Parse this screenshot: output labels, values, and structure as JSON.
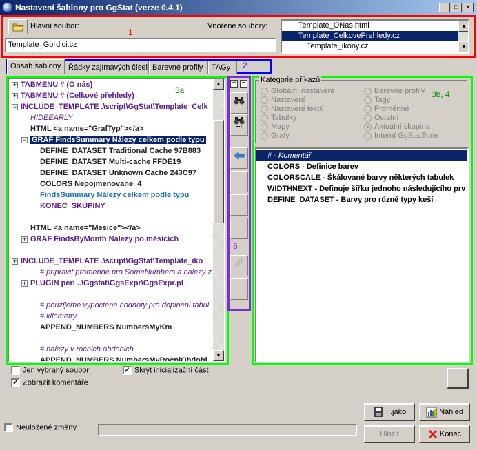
{
  "window": {
    "title": "Nastavení šablony pro GgStat (verze 0.4.1)",
    "btn_minimize": "_",
    "btn_maximize": "□",
    "btn_close": "×"
  },
  "header": {
    "main_file_label": "Hlavní soubor:",
    "main_file_value": "Template_Gordici.cz",
    "nested_files_label": "Vnořené soubory:",
    "nested_files": [
      "Template_ONas.html",
      "Template_CelkovePrehledy.cz",
      "Template_ikony.cz"
    ],
    "nested_selected_index": 1
  },
  "annotations": {
    "a1": "1",
    "a2": "2",
    "a3a": "3a",
    "a3b4": "3b, 4",
    "a6": "6"
  },
  "tabs": [
    "Obsah šablony",
    "Řádky zajímavých čísel",
    "Barevné profily",
    "TAGy"
  ],
  "tree": [
    {
      "text": "TABMENU  # (O nás)",
      "style": "purple",
      "exp": "+",
      "indent": 0
    },
    {
      "text": "TABMENU  # (Celkové přehledy)",
      "style": "purple",
      "exp": "+",
      "indent": 0
    },
    {
      "text": "INCLUDE_TEMPLATE .\\script\\GgStat\\Template_Celk",
      "style": "purple",
      "exp": "−",
      "indent": 0
    },
    {
      "text": "HIDEEARLY",
      "style": "comment",
      "exp": "",
      "indent": 1
    },
    {
      "text": "HTML <a name=\"GrafTyp\"></a>",
      "style": "black",
      "exp": "",
      "indent": 1
    },
    {
      "text": "GRAF FindsSummary Nálezy celkem podle typu",
      "style": "selected",
      "exp": "−",
      "indent": 1
    },
    {
      "text": "DEFINE_DATASET Traditional Cache 97B883",
      "style": "black",
      "exp": "",
      "indent": 2
    },
    {
      "text": "DEFINE_DATASET Multi-cache FFDE19",
      "style": "black",
      "exp": "",
      "indent": 2
    },
    {
      "text": "DEFINE_DATASET Unknown Cache 243C97",
      "style": "black",
      "exp": "",
      "indent": 2
    },
    {
      "text": "COLORS Nepojmenovane_4",
      "style": "black",
      "exp": "",
      "indent": 2
    },
    {
      "text": "FindsSummary Nálezy celkem podle typu",
      "style": "blue",
      "exp": "",
      "indent": 2
    },
    {
      "text": "KONEC_SKUPINY",
      "style": "purple",
      "exp": "",
      "indent": 2
    },
    {
      "text": "",
      "style": "black",
      "exp": "",
      "indent": 0
    },
    {
      "text": "HTML <a name=\"Mesice\"></a>",
      "style": "black",
      "exp": "",
      "indent": 1
    },
    {
      "text": "GRAF FindsByMonth Nálezy po měsících",
      "style": "purple",
      "exp": "+",
      "indent": 1
    },
    {
      "text": "",
      "style": "black",
      "exp": "",
      "indent": 0
    },
    {
      "text": "INCLUDE_TEMPLATE .\\script\\GgStat\\Template_iko",
      "style": "purple",
      "exp": "+",
      "indent": 0
    },
    {
      "text": "# pripravit promenne pro SomeNumbers a nalezy z",
      "style": "comment",
      "exp": "",
      "indent": 2
    },
    {
      "text": "PLUGIN perl ..\\Ggstat\\GgsExpr\\GgsExpr.pl",
      "style": "purple",
      "exp": "+",
      "indent": 1
    },
    {
      "text": "",
      "style": "black",
      "exp": "",
      "indent": 0
    },
    {
      "text": "# pouzijeme vypoctene hodnoty pro doplneni tabul",
      "style": "comment",
      "exp": "",
      "indent": 2
    },
    {
      "text": "# kilometry",
      "style": "comment",
      "exp": "",
      "indent": 2
    },
    {
      "text": "APPEND_NUMBERS NumbersMyKm",
      "style": "black",
      "exp": "",
      "indent": 2
    },
    {
      "text": "",
      "style": "black",
      "exp": "",
      "indent": 0
    },
    {
      "text": "# nalezy v rocnich obdobich",
      "style": "comment",
      "exp": "",
      "indent": 2
    },
    {
      "text": "APPEND_NUMBERS NumbersMyRocniObdobi",
      "style": "black",
      "exp": "",
      "indent": 2
    }
  ],
  "category": {
    "label": "Kategorie příkazů",
    "left": [
      "Globální nastavení",
      "Nastavení",
      "Nastavení textů",
      "Tabulky",
      "Mapy",
      "Grafy"
    ],
    "right": [
      "Barevné profily",
      "Tagy",
      "Proměnné",
      "Ostatní",
      "Aktuální skupina",
      "Interní GgStatTune"
    ],
    "selected": "Aktuální skupina"
  },
  "commands": [
    {
      "text": "# - Komentář",
      "selected": true
    },
    {
      "text": "COLORS - Definice barev",
      "selected": false
    },
    {
      "text": "COLORSCALE - Škálované barvy některých tabulek",
      "selected": false
    },
    {
      "text": "WIDTHNEXT - Definuje šířku jednoho následujícího prv",
      "selected": false
    },
    {
      "text": "DEFINE_DATASET - Barvy pro různé typy keší",
      "selected": false
    }
  ],
  "options": {
    "only_selected_file": "Jen vybraný soubor",
    "only_selected_file_checked": false,
    "hide_init": "Skrýt inicializační část",
    "hide_init_checked": true,
    "show_comments": "Zobrazit komentáře",
    "show_comments_checked": true
  },
  "footer": {
    "unsaved_label": "Neuložené změny",
    "unsaved_checked": false,
    "save_as_label": "...jako",
    "preview_label": "Náhled",
    "save_label": "Uložit",
    "close_label": "Konec"
  },
  "icons": {
    "folder": "folder-icon",
    "binoculars": "binoculars-icon",
    "arrow_left": "arrow-left-icon",
    "pencil": "pencil-icon",
    "save": "save-disk-icon",
    "chart": "bar-chart-icon",
    "close": "red-x-icon"
  },
  "colors": {
    "frame_red": "#ff0000",
    "frame_blue": "#0000ff",
    "frame_green": "#00ff00",
    "frame_purple": "#7b2fd0",
    "selection": "#0a246a"
  }
}
